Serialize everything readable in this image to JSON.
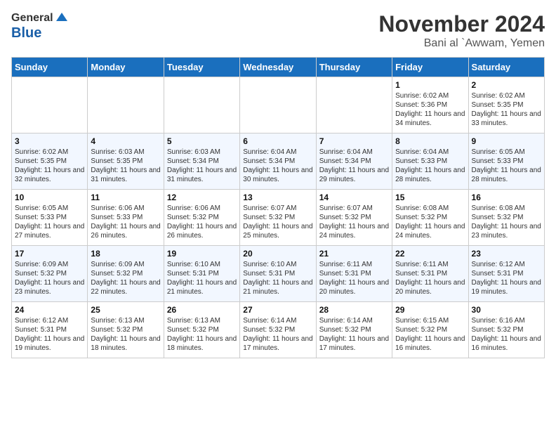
{
  "header": {
    "logo_general": "General",
    "logo_blue": "Blue",
    "month": "November 2024",
    "location": "Bani al `Awwam, Yemen"
  },
  "days_of_week": [
    "Sunday",
    "Monday",
    "Tuesday",
    "Wednesday",
    "Thursday",
    "Friday",
    "Saturday"
  ],
  "weeks": [
    [
      {
        "day": "",
        "info": ""
      },
      {
        "day": "",
        "info": ""
      },
      {
        "day": "",
        "info": ""
      },
      {
        "day": "",
        "info": ""
      },
      {
        "day": "",
        "info": ""
      },
      {
        "day": "1",
        "info": "Sunrise: 6:02 AM\nSunset: 5:36 PM\nDaylight: 11 hours and 34 minutes."
      },
      {
        "day": "2",
        "info": "Sunrise: 6:02 AM\nSunset: 5:35 PM\nDaylight: 11 hours and 33 minutes."
      }
    ],
    [
      {
        "day": "3",
        "info": "Sunrise: 6:02 AM\nSunset: 5:35 PM\nDaylight: 11 hours and 32 minutes."
      },
      {
        "day": "4",
        "info": "Sunrise: 6:03 AM\nSunset: 5:35 PM\nDaylight: 11 hours and 31 minutes."
      },
      {
        "day": "5",
        "info": "Sunrise: 6:03 AM\nSunset: 5:34 PM\nDaylight: 11 hours and 31 minutes."
      },
      {
        "day": "6",
        "info": "Sunrise: 6:04 AM\nSunset: 5:34 PM\nDaylight: 11 hours and 30 minutes."
      },
      {
        "day": "7",
        "info": "Sunrise: 6:04 AM\nSunset: 5:34 PM\nDaylight: 11 hours and 29 minutes."
      },
      {
        "day": "8",
        "info": "Sunrise: 6:04 AM\nSunset: 5:33 PM\nDaylight: 11 hours and 28 minutes."
      },
      {
        "day": "9",
        "info": "Sunrise: 6:05 AM\nSunset: 5:33 PM\nDaylight: 11 hours and 28 minutes."
      }
    ],
    [
      {
        "day": "10",
        "info": "Sunrise: 6:05 AM\nSunset: 5:33 PM\nDaylight: 11 hours and 27 minutes."
      },
      {
        "day": "11",
        "info": "Sunrise: 6:06 AM\nSunset: 5:33 PM\nDaylight: 11 hours and 26 minutes."
      },
      {
        "day": "12",
        "info": "Sunrise: 6:06 AM\nSunset: 5:32 PM\nDaylight: 11 hours and 26 minutes."
      },
      {
        "day": "13",
        "info": "Sunrise: 6:07 AM\nSunset: 5:32 PM\nDaylight: 11 hours and 25 minutes."
      },
      {
        "day": "14",
        "info": "Sunrise: 6:07 AM\nSunset: 5:32 PM\nDaylight: 11 hours and 24 minutes."
      },
      {
        "day": "15",
        "info": "Sunrise: 6:08 AM\nSunset: 5:32 PM\nDaylight: 11 hours and 24 minutes."
      },
      {
        "day": "16",
        "info": "Sunrise: 6:08 AM\nSunset: 5:32 PM\nDaylight: 11 hours and 23 minutes."
      }
    ],
    [
      {
        "day": "17",
        "info": "Sunrise: 6:09 AM\nSunset: 5:32 PM\nDaylight: 11 hours and 23 minutes."
      },
      {
        "day": "18",
        "info": "Sunrise: 6:09 AM\nSunset: 5:32 PM\nDaylight: 11 hours and 22 minutes."
      },
      {
        "day": "19",
        "info": "Sunrise: 6:10 AM\nSunset: 5:31 PM\nDaylight: 11 hours and 21 minutes."
      },
      {
        "day": "20",
        "info": "Sunrise: 6:10 AM\nSunset: 5:31 PM\nDaylight: 11 hours and 21 minutes."
      },
      {
        "day": "21",
        "info": "Sunrise: 6:11 AM\nSunset: 5:31 PM\nDaylight: 11 hours and 20 minutes."
      },
      {
        "day": "22",
        "info": "Sunrise: 6:11 AM\nSunset: 5:31 PM\nDaylight: 11 hours and 20 minutes."
      },
      {
        "day": "23",
        "info": "Sunrise: 6:12 AM\nSunset: 5:31 PM\nDaylight: 11 hours and 19 minutes."
      }
    ],
    [
      {
        "day": "24",
        "info": "Sunrise: 6:12 AM\nSunset: 5:31 PM\nDaylight: 11 hours and 19 minutes."
      },
      {
        "day": "25",
        "info": "Sunrise: 6:13 AM\nSunset: 5:32 PM\nDaylight: 11 hours and 18 minutes."
      },
      {
        "day": "26",
        "info": "Sunrise: 6:13 AM\nSunset: 5:32 PM\nDaylight: 11 hours and 18 minutes."
      },
      {
        "day": "27",
        "info": "Sunrise: 6:14 AM\nSunset: 5:32 PM\nDaylight: 11 hours and 17 minutes."
      },
      {
        "day": "28",
        "info": "Sunrise: 6:14 AM\nSunset: 5:32 PM\nDaylight: 11 hours and 17 minutes."
      },
      {
        "day": "29",
        "info": "Sunrise: 6:15 AM\nSunset: 5:32 PM\nDaylight: 11 hours and 16 minutes."
      },
      {
        "day": "30",
        "info": "Sunrise: 6:16 AM\nSunset: 5:32 PM\nDaylight: 11 hours and 16 minutes."
      }
    ]
  ]
}
